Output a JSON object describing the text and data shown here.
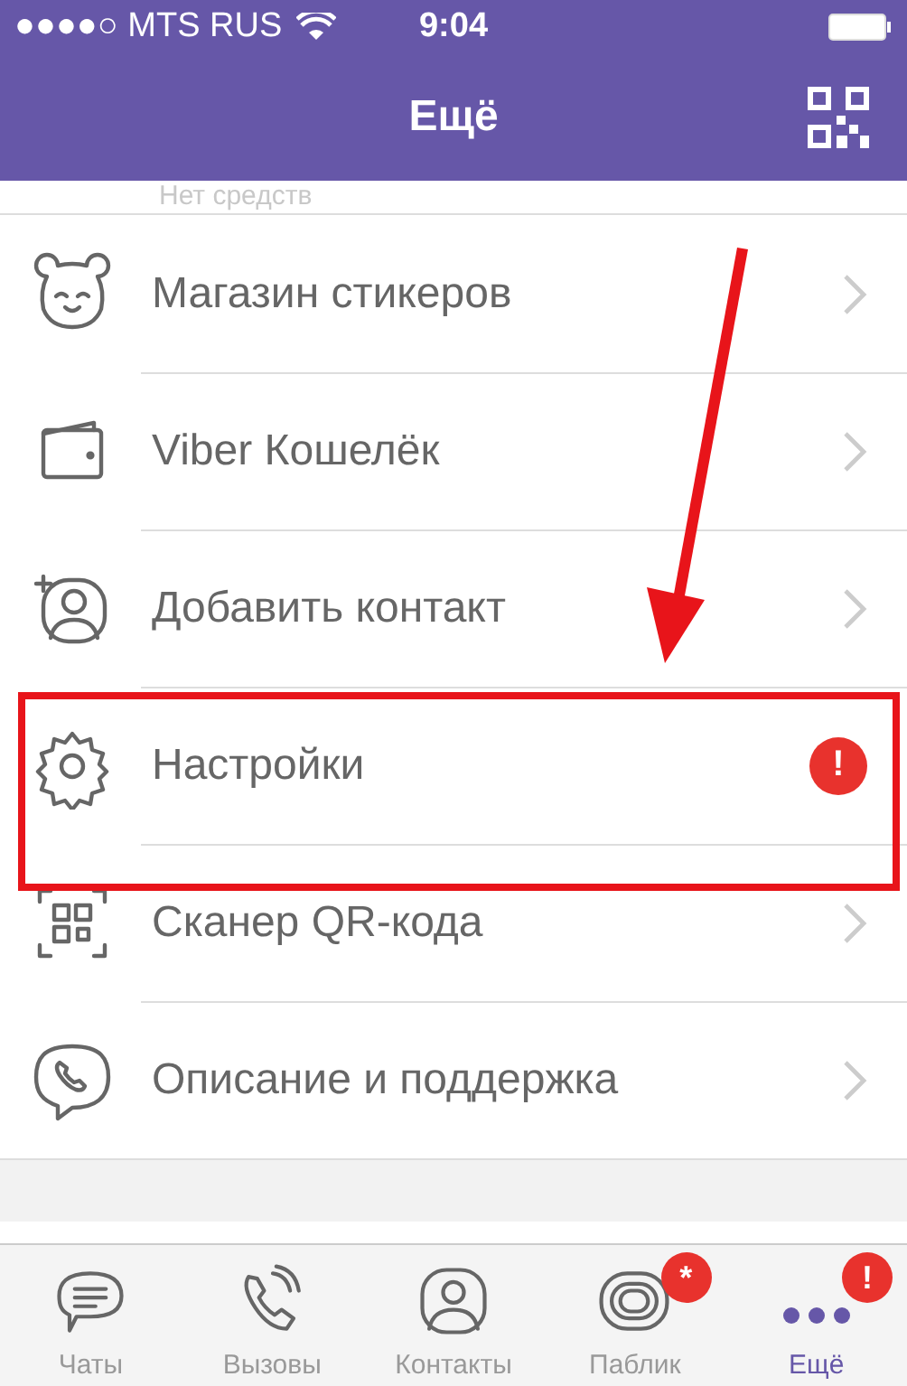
{
  "status_bar": {
    "carrier": "●●●●○ MTS RUS",
    "time": "9:04"
  },
  "nav": {
    "title": "Ещё"
  },
  "balance_hint": "Нет средств",
  "menu": [
    {
      "kind": "sticker",
      "label": "Магазин стикеров"
    },
    {
      "kind": "wallet",
      "label": "Viber Кошелёк"
    },
    {
      "kind": "contact",
      "label": "Добавить контакт"
    },
    {
      "kind": "settings",
      "label": "Настройки",
      "badge": "!",
      "highlighted": true
    },
    {
      "kind": "scanner",
      "label": "Сканер QR-кода"
    },
    {
      "kind": "support",
      "label": "Описание и поддержка"
    }
  ],
  "tabs": [
    {
      "kind": "chat",
      "label": "Чаты",
      "selected": false
    },
    {
      "kind": "call",
      "label": "Вызовы",
      "selected": false
    },
    {
      "kind": "contact",
      "label": "Контакты",
      "selected": false
    },
    {
      "kind": "public",
      "label": "Паблик",
      "selected": false,
      "badge": "*"
    },
    {
      "kind": "more",
      "label": "Ещё",
      "selected": true,
      "badge": "!"
    }
  ]
}
